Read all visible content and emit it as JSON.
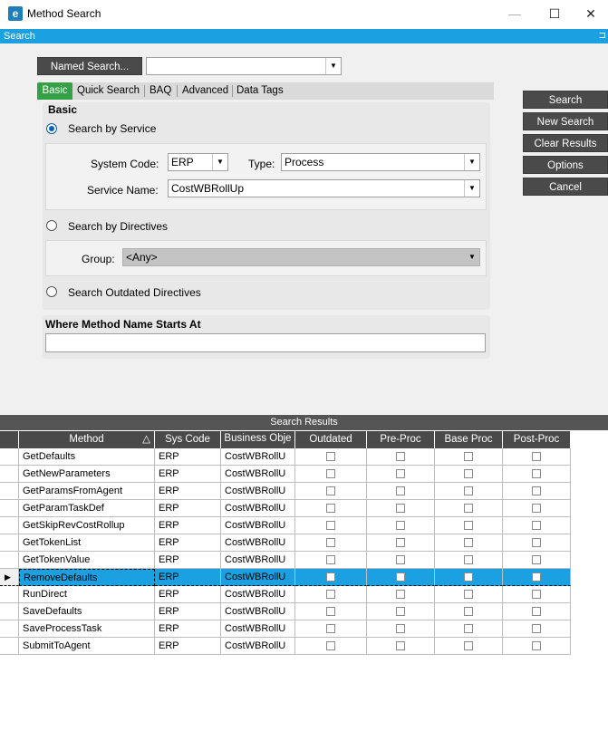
{
  "window": {
    "title": "Method Search",
    "minimize": "—",
    "maximize": "☐",
    "close": "✕",
    "icon_letter": "e"
  },
  "search_bar": {
    "label": "Search",
    "pin": "⊐"
  },
  "named_search": {
    "button_label": "Named Search...",
    "value": ""
  },
  "tabs": [
    {
      "label": "Basic",
      "active": true
    },
    {
      "label": "Quick Search",
      "active": false
    },
    {
      "label": "BAQ",
      "active": false
    },
    {
      "label": "Advanced",
      "active": false
    },
    {
      "label": "Data Tags",
      "active": false
    }
  ],
  "basic": {
    "section_title": "Basic",
    "by_service": {
      "label": "Search by Service",
      "selected": true
    },
    "system_code": {
      "label": "System Code:",
      "value": "ERP"
    },
    "type": {
      "label": "Type:",
      "value": "Process"
    },
    "service_name": {
      "label": "Service Name:",
      "value": "CostWBRollUp"
    },
    "by_directives": {
      "label": "Search by Directives",
      "selected": false
    },
    "group": {
      "label": "Group:",
      "value": "<Any>"
    },
    "outdated": {
      "label": "Search Outdated Directives",
      "selected": false
    }
  },
  "where_method": {
    "label": "Where Method Name Starts At",
    "value": ""
  },
  "actions": {
    "search": "Search",
    "new_search": "New Search",
    "clear_results": "Clear Results",
    "options": "Options",
    "cancel": "Cancel"
  },
  "results": {
    "title": "Search Results",
    "columns": [
      "Method",
      "Sys Code",
      "Business Obje",
      "Outdated",
      "Pre-Proc",
      "Base Proc",
      "Post-Proc"
    ],
    "sort_indicator": "△",
    "rows": [
      {
        "method": "GetDefaults",
        "sys": "ERP",
        "bo": "CostWBRollU",
        "selected": false
      },
      {
        "method": "GetNewParameters",
        "sys": "ERP",
        "bo": "CostWBRollU",
        "selected": false
      },
      {
        "method": "GetParamsFromAgent",
        "sys": "ERP",
        "bo": "CostWBRollU",
        "selected": false
      },
      {
        "method": "GetParamTaskDef",
        "sys": "ERP",
        "bo": "CostWBRollU",
        "selected": false
      },
      {
        "method": "GetSkipRevCostRollup",
        "sys": "ERP",
        "bo": "CostWBRollU",
        "selected": false
      },
      {
        "method": "GetTokenList",
        "sys": "ERP",
        "bo": "CostWBRollU",
        "selected": false
      },
      {
        "method": "GetTokenValue",
        "sys": "ERP",
        "bo": "CostWBRollU",
        "selected": false
      },
      {
        "method": "RemoveDefaults",
        "sys": "ERP",
        "bo": "CostWBRollU",
        "selected": true
      },
      {
        "method": "RunDirect",
        "sys": "ERP",
        "bo": "CostWBRollU",
        "selected": false
      },
      {
        "method": "SaveDefaults",
        "sys": "ERP",
        "bo": "CostWBRollU",
        "selected": false
      },
      {
        "method": "SaveProcessTask",
        "sys": "ERP",
        "bo": "CostWBRollU",
        "selected": false
      },
      {
        "method": "SubmitToAgent",
        "sys": "ERP",
        "bo": "CostWBRollU",
        "selected": false
      }
    ]
  },
  "colors": {
    "accent": "#1ba1e2",
    "tab_active": "#35a045",
    "button_dark": "#4a4a4a"
  }
}
